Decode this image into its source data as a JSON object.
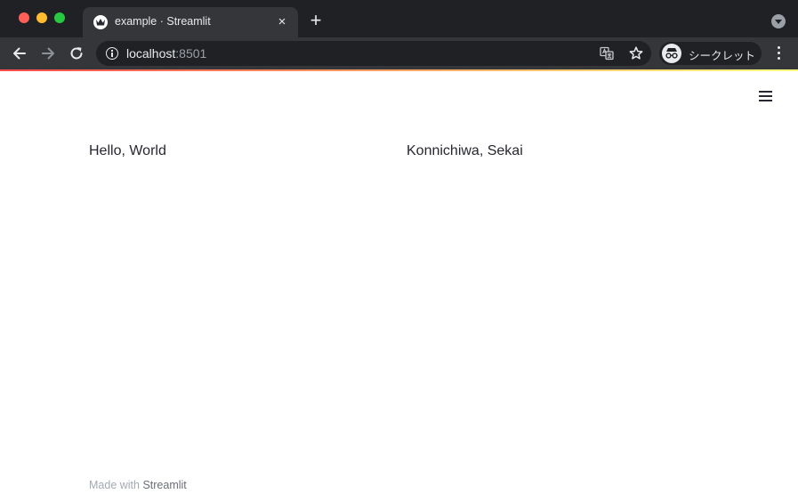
{
  "browser": {
    "tab": {
      "title": "example · Streamlit",
      "close_glyph": "×",
      "favicon": "streamlit-crown-icon"
    },
    "new_tab_glyph": "+",
    "address": {
      "host": "localhost",
      "port": ":8501"
    },
    "incognito_label": "シークレット",
    "colors": {
      "titlebar": "#202124",
      "toolbar": "#35363a",
      "omnibox": "#202124",
      "text": "#e8eaed"
    }
  },
  "app": {
    "columns": [
      "Hello, World",
      "Konnichiwa, Sekai"
    ],
    "footer": {
      "prefix": "Made with ",
      "link": "Streamlit"
    },
    "colors": {
      "text": "#262730",
      "decoration_start": "#ff4b4b",
      "decoration_end": "#fffd80"
    }
  }
}
